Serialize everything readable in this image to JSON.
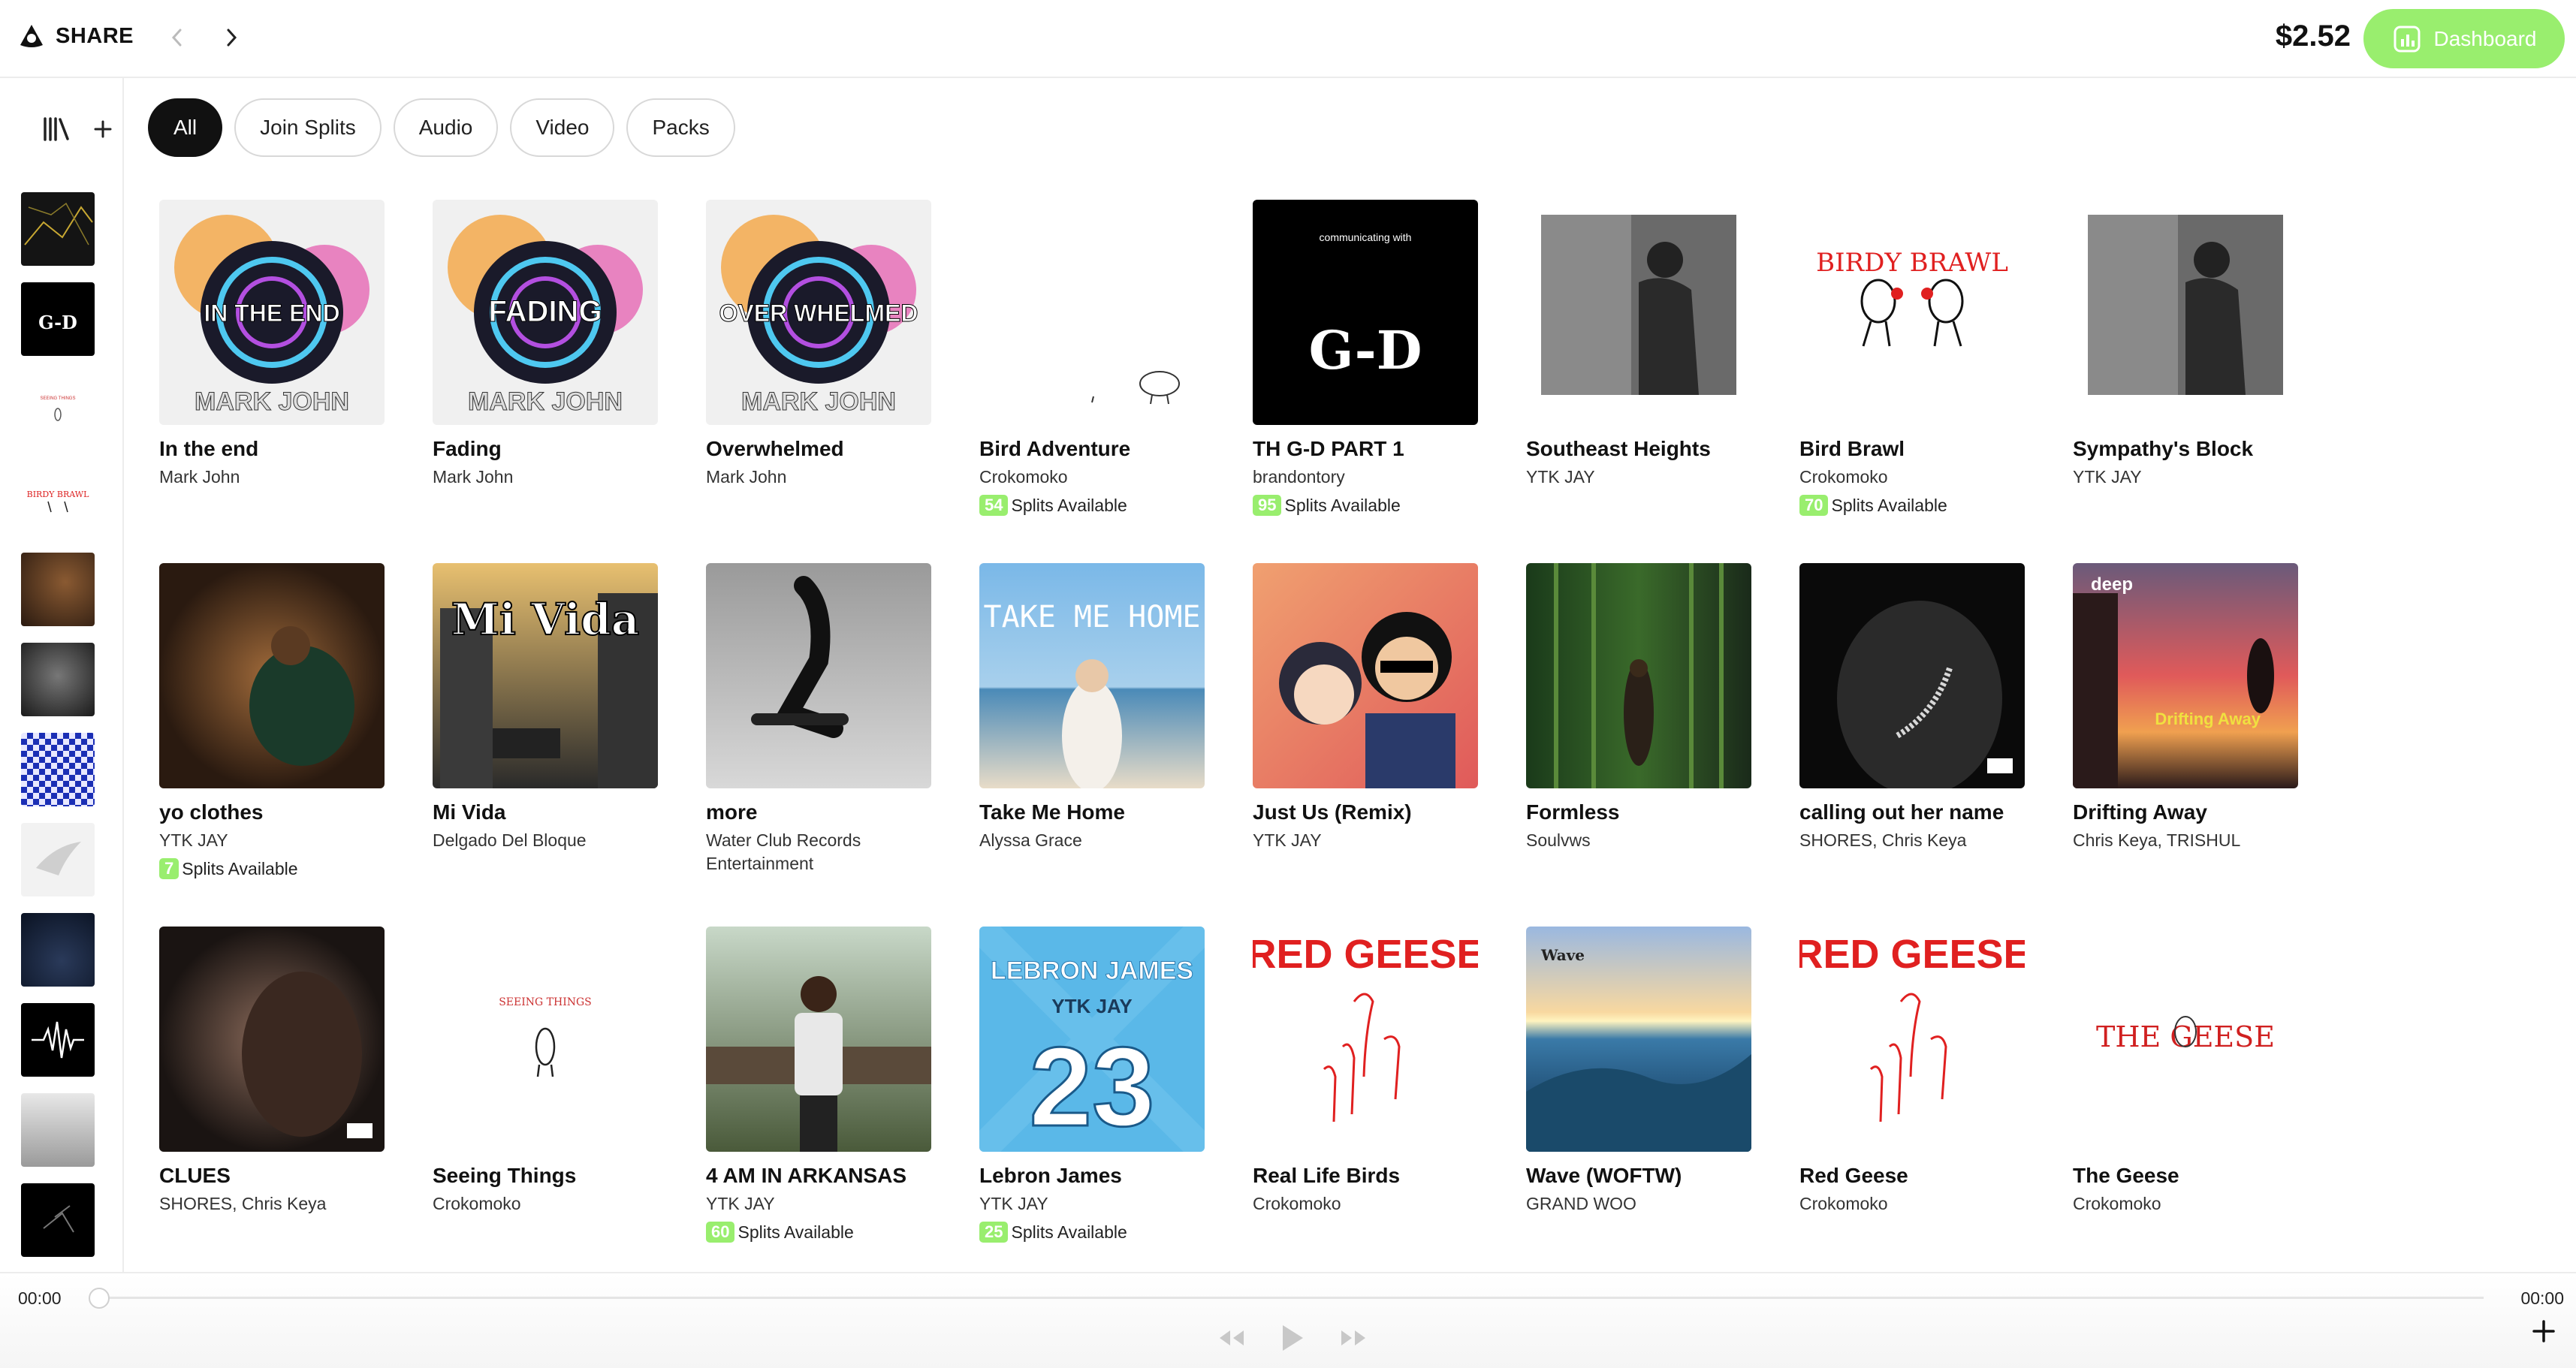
{
  "header": {
    "brand": "SHARE",
    "balance": "$2.52",
    "dashboard_label": "Dashboard",
    "accent_color": "#99ee6e"
  },
  "filters": [
    "All",
    "Join Splits",
    "Audio",
    "Video",
    "Packs"
  ],
  "active_filter": "All",
  "splits_suffix": "Splits Available",
  "albums": [
    {
      "title": "In the end",
      "artist": "Mark John",
      "cover_text": "IN THE END",
      "cover_sub": "MARK JOHN"
    },
    {
      "title": "Fading",
      "artist": "Mark John",
      "cover_text": "FADING",
      "cover_sub": "MARK JOHN"
    },
    {
      "title": "Overwhelmed",
      "artist": "Mark John",
      "cover_text": "OVER WHELMED",
      "cover_sub": "MARK JOHN"
    },
    {
      "title": "Bird Adventure",
      "artist": "Crokomoko",
      "splits": "54"
    },
    {
      "title": "TH G-D PART 1",
      "artist": "brandontory",
      "splits": "95",
      "cover_text": "communicating with",
      "cover_sub": "G-D"
    },
    {
      "title": "Southeast Heights",
      "artist": "YTK JAY"
    },
    {
      "title": "Bird Brawl",
      "artist": "Crokomoko",
      "splits": "70",
      "cover_text": "BIRDY BRAWL"
    },
    {
      "title": "Sympathy's Block",
      "artist": "YTK JAY"
    },
    {
      "title": "yo clothes",
      "artist": "YTK JAY",
      "splits": "7"
    },
    {
      "title": "Mi Vida",
      "artist": "Delgado Del Bloque",
      "cover_text": "Mi Vida"
    },
    {
      "title": "more",
      "artist": "Water Club Records Entertainment"
    },
    {
      "title": "Take Me Home",
      "artist": "Alyssa Grace",
      "cover_text": "TAKE ME HOME"
    },
    {
      "title": "Just Us (Remix)",
      "artist": "YTK JAY"
    },
    {
      "title": "Formless",
      "artist": "Soulvws"
    },
    {
      "title": "calling out her name",
      "artist": "SHORES, Chris Keya"
    },
    {
      "title": "Drifting Away",
      "artist": "Chris Keya, TRISHUL",
      "cover_text": "Drifting Away",
      "cover_sub": "deep"
    },
    {
      "title": "CLUES",
      "artist": "SHORES, Chris Keya"
    },
    {
      "title": "Seeing Things",
      "artist": "Crokomoko",
      "cover_text": "SEEING THINGS"
    },
    {
      "title": "4 AM IN ARKANSAS",
      "artist": "YTK JAY",
      "splits": "60"
    },
    {
      "title": "Lebron James",
      "artist": "YTK JAY",
      "splits": "25",
      "cover_text": "LEBRON JAMES",
      "cover_sub": "YTK JAY",
      "cover_num": "23"
    },
    {
      "title": "Real Life Birds",
      "artist": "Crokomoko",
      "cover_text": "RED GEESE"
    },
    {
      "title": "Wave (WOFTW)",
      "artist": "GRAND WOO",
      "cover_text": "Wave"
    },
    {
      "title": "Red Geese",
      "artist": "Crokomoko",
      "cover_text": "RED GEESE"
    },
    {
      "title": "The Geese",
      "artist": "Crokomoko",
      "cover_text": "THE GEESE"
    }
  ],
  "player": {
    "current_time": "00:00",
    "total_time": "00:00",
    "progress": 0
  }
}
